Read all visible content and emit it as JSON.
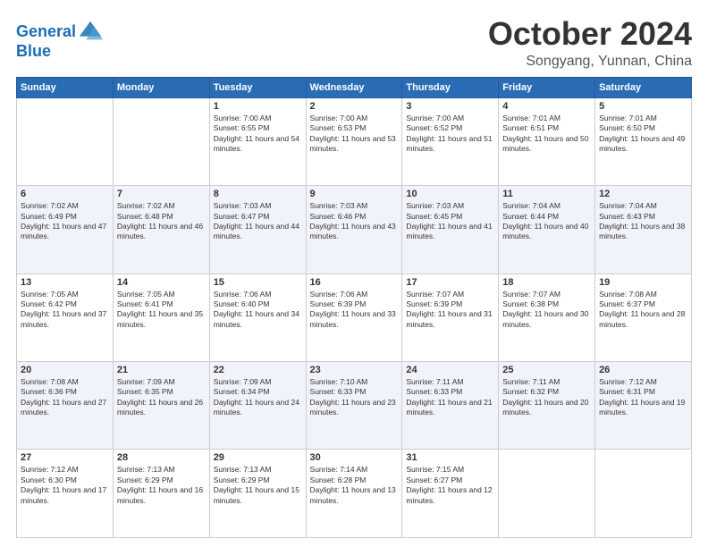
{
  "header": {
    "logo_line1": "General",
    "logo_line2": "Blue",
    "month": "October 2024",
    "location": "Songyang, Yunnan, China"
  },
  "weekdays": [
    "Sunday",
    "Monday",
    "Tuesday",
    "Wednesday",
    "Thursday",
    "Friday",
    "Saturday"
  ],
  "weeks": [
    [
      {
        "day": "",
        "info": ""
      },
      {
        "day": "",
        "info": ""
      },
      {
        "day": "1",
        "info": "Sunrise: 7:00 AM\nSunset: 6:55 PM\nDaylight: 11 hours and 54 minutes."
      },
      {
        "day": "2",
        "info": "Sunrise: 7:00 AM\nSunset: 6:53 PM\nDaylight: 11 hours and 53 minutes."
      },
      {
        "day": "3",
        "info": "Sunrise: 7:00 AM\nSunset: 6:52 PM\nDaylight: 11 hours and 51 minutes."
      },
      {
        "day": "4",
        "info": "Sunrise: 7:01 AM\nSunset: 6:51 PM\nDaylight: 11 hours and 50 minutes."
      },
      {
        "day": "5",
        "info": "Sunrise: 7:01 AM\nSunset: 6:50 PM\nDaylight: 11 hours and 49 minutes."
      }
    ],
    [
      {
        "day": "6",
        "info": "Sunrise: 7:02 AM\nSunset: 6:49 PM\nDaylight: 11 hours and 47 minutes."
      },
      {
        "day": "7",
        "info": "Sunrise: 7:02 AM\nSunset: 6:48 PM\nDaylight: 11 hours and 46 minutes."
      },
      {
        "day": "8",
        "info": "Sunrise: 7:03 AM\nSunset: 6:47 PM\nDaylight: 11 hours and 44 minutes."
      },
      {
        "day": "9",
        "info": "Sunrise: 7:03 AM\nSunset: 6:46 PM\nDaylight: 11 hours and 43 minutes."
      },
      {
        "day": "10",
        "info": "Sunrise: 7:03 AM\nSunset: 6:45 PM\nDaylight: 11 hours and 41 minutes."
      },
      {
        "day": "11",
        "info": "Sunrise: 7:04 AM\nSunset: 6:44 PM\nDaylight: 11 hours and 40 minutes."
      },
      {
        "day": "12",
        "info": "Sunrise: 7:04 AM\nSunset: 6:43 PM\nDaylight: 11 hours and 38 minutes."
      }
    ],
    [
      {
        "day": "13",
        "info": "Sunrise: 7:05 AM\nSunset: 6:42 PM\nDaylight: 11 hours and 37 minutes."
      },
      {
        "day": "14",
        "info": "Sunrise: 7:05 AM\nSunset: 6:41 PM\nDaylight: 11 hours and 35 minutes."
      },
      {
        "day": "15",
        "info": "Sunrise: 7:06 AM\nSunset: 6:40 PM\nDaylight: 11 hours and 34 minutes."
      },
      {
        "day": "16",
        "info": "Sunrise: 7:06 AM\nSunset: 6:39 PM\nDaylight: 11 hours and 33 minutes."
      },
      {
        "day": "17",
        "info": "Sunrise: 7:07 AM\nSunset: 6:39 PM\nDaylight: 11 hours and 31 minutes."
      },
      {
        "day": "18",
        "info": "Sunrise: 7:07 AM\nSunset: 6:38 PM\nDaylight: 11 hours and 30 minutes."
      },
      {
        "day": "19",
        "info": "Sunrise: 7:08 AM\nSunset: 6:37 PM\nDaylight: 11 hours and 28 minutes."
      }
    ],
    [
      {
        "day": "20",
        "info": "Sunrise: 7:08 AM\nSunset: 6:36 PM\nDaylight: 11 hours and 27 minutes."
      },
      {
        "day": "21",
        "info": "Sunrise: 7:09 AM\nSunset: 6:35 PM\nDaylight: 11 hours and 26 minutes."
      },
      {
        "day": "22",
        "info": "Sunrise: 7:09 AM\nSunset: 6:34 PM\nDaylight: 11 hours and 24 minutes."
      },
      {
        "day": "23",
        "info": "Sunrise: 7:10 AM\nSunset: 6:33 PM\nDaylight: 11 hours and 23 minutes."
      },
      {
        "day": "24",
        "info": "Sunrise: 7:11 AM\nSunset: 6:33 PM\nDaylight: 11 hours and 21 minutes."
      },
      {
        "day": "25",
        "info": "Sunrise: 7:11 AM\nSunset: 6:32 PM\nDaylight: 11 hours and 20 minutes."
      },
      {
        "day": "26",
        "info": "Sunrise: 7:12 AM\nSunset: 6:31 PM\nDaylight: 11 hours and 19 minutes."
      }
    ],
    [
      {
        "day": "27",
        "info": "Sunrise: 7:12 AM\nSunset: 6:30 PM\nDaylight: 11 hours and 17 minutes."
      },
      {
        "day": "28",
        "info": "Sunrise: 7:13 AM\nSunset: 6:29 PM\nDaylight: 11 hours and 16 minutes."
      },
      {
        "day": "29",
        "info": "Sunrise: 7:13 AM\nSunset: 6:29 PM\nDaylight: 11 hours and 15 minutes."
      },
      {
        "day": "30",
        "info": "Sunrise: 7:14 AM\nSunset: 6:28 PM\nDaylight: 11 hours and 13 minutes."
      },
      {
        "day": "31",
        "info": "Sunrise: 7:15 AM\nSunset: 6:27 PM\nDaylight: 11 hours and 12 minutes."
      },
      {
        "day": "",
        "info": ""
      },
      {
        "day": "",
        "info": ""
      }
    ]
  ]
}
